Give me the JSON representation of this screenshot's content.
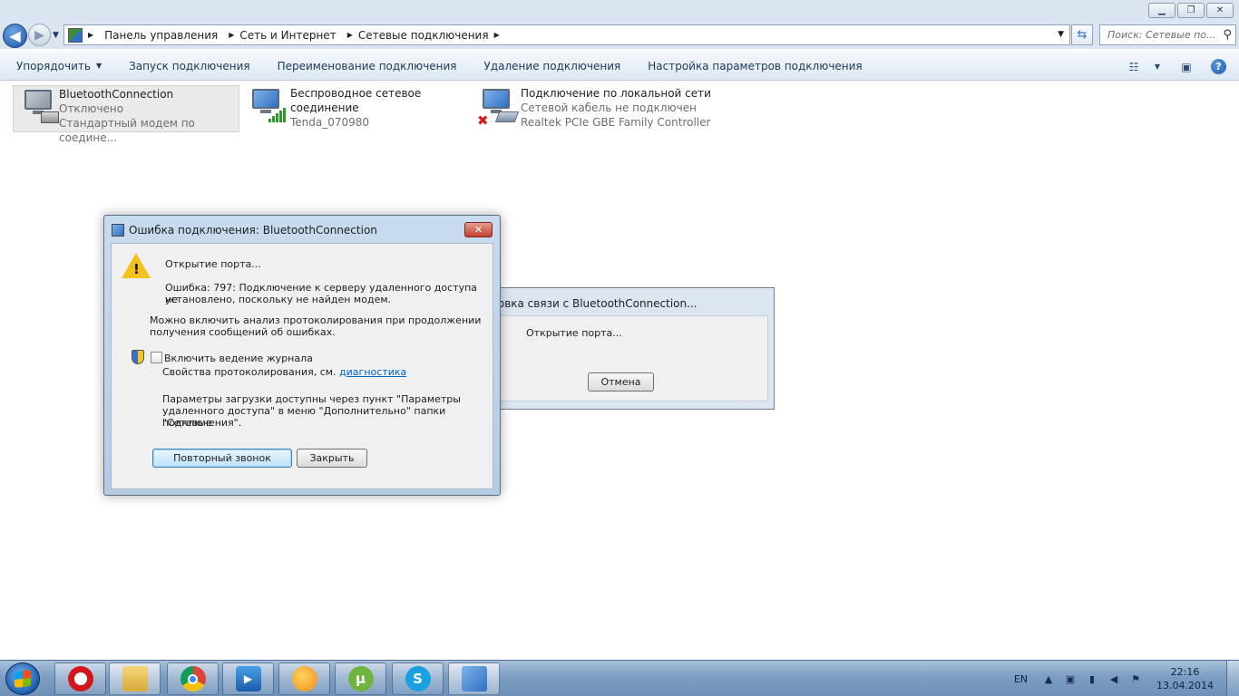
{
  "address_bar": {
    "crumbs": [
      "Панель управления",
      "Сеть и Интернет",
      "Сетевые подключения"
    ],
    "search_placeholder": "Поиск: Сетевые по..."
  },
  "toolbar": {
    "organize": "Упорядочить",
    "items": [
      "Запуск подключения",
      "Переименование подключения",
      "Удаление подключения",
      "Настройка параметров подключения"
    ]
  },
  "connections": [
    {
      "name": "BluetoothConnection",
      "status": "Отключено",
      "device": "Стандартный модем по соедине..."
    },
    {
      "name": "Беспроводное сетевое",
      "name2": "соединение",
      "status": "Tenda_070980"
    },
    {
      "name": "Подключение по локальной сети",
      "status": "Сетевой кабель не подключен",
      "device": "Realtek PCIe GBE Family Controller"
    }
  ],
  "bg_dialog": {
    "title": "новка связи с BluetoothConnection...",
    "message": "Открытие порта...",
    "cancel": "Отмена"
  },
  "error_dialog": {
    "title": "Ошибка подключения: BluetoothConnection",
    "heading": "Открытие порта...",
    "error_line1": "Ошибка: 797: Подключение к серверу удаленного доступа не",
    "error_line2": "установлено, поскольку не найден модем.",
    "info_line1": "Можно включить анализ протоколирования при продолжении",
    "info_line2": "получения сообщений об ошибках.",
    "checkbox_label": "Включить ведение журнала",
    "diag_prefix": "Свойства протоколирования, см.",
    "diag_link": "диагностика",
    "params_line1": "Параметры загрузки доступны через пункт \"Параметры",
    "params_line2": "удаленного доступа\" в меню \"Дополнительно\" папки \"Сетевые",
    "params_line3": "подключения\".",
    "redial": "Повторный звонок",
    "close": "Закрыть"
  },
  "taskbar": {
    "apps": [
      "opera-icon",
      "explorer-icon",
      "chrome-icon",
      "media-player-icon",
      "weather-gadget-icon",
      "utorrent-icon",
      "skype-icon",
      "network-control-panel-icon"
    ],
    "language": "EN",
    "time": "22:16",
    "date": "13.04.2014"
  }
}
